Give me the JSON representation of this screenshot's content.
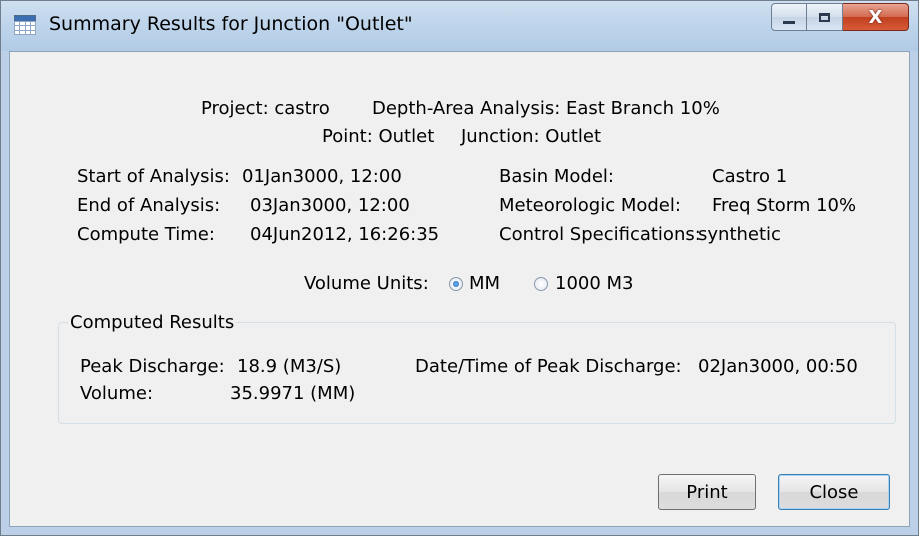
{
  "window": {
    "title": "Summary Results for Junction \"Outlet\"",
    "close_glyph": "X"
  },
  "header": {
    "project": "Project: castro",
    "analysis": "Depth-Area Analysis: East Branch 10%",
    "point": "Point: Outlet",
    "junction": "Junction: Outlet"
  },
  "run_info": {
    "start_label": "Start of Analysis:",
    "start_value": "01Jan3000, 12:00",
    "end_label": "End of Analysis:",
    "end_value": "03Jan3000, 12:00",
    "compute_label": "Compute Time:",
    "compute_value": "04Jun2012, 16:26:35",
    "basin_label": "Basin Model:",
    "basin_value": "Castro 1",
    "met_label": "Meteorologic Model:",
    "met_value": "Freq Storm 10%",
    "control_label": "Control Specifications:",
    "control_value": "synthetic"
  },
  "volume_units": {
    "label": "Volume Units:",
    "options": [
      "MM",
      "1000 M3"
    ],
    "selected": "MM"
  },
  "results": {
    "group_title": "Computed Results",
    "peak_label": "Peak Discharge:",
    "peak_value": "18.9 (M3/S)",
    "volume_label": "Volume:",
    "volume_value": "35.9971 (MM)",
    "peak_time_label": "Date/Time of Peak Discharge:",
    "peak_time_value": "02Jan3000, 00:50"
  },
  "buttons": {
    "print": "Print",
    "close": "Close"
  }
}
